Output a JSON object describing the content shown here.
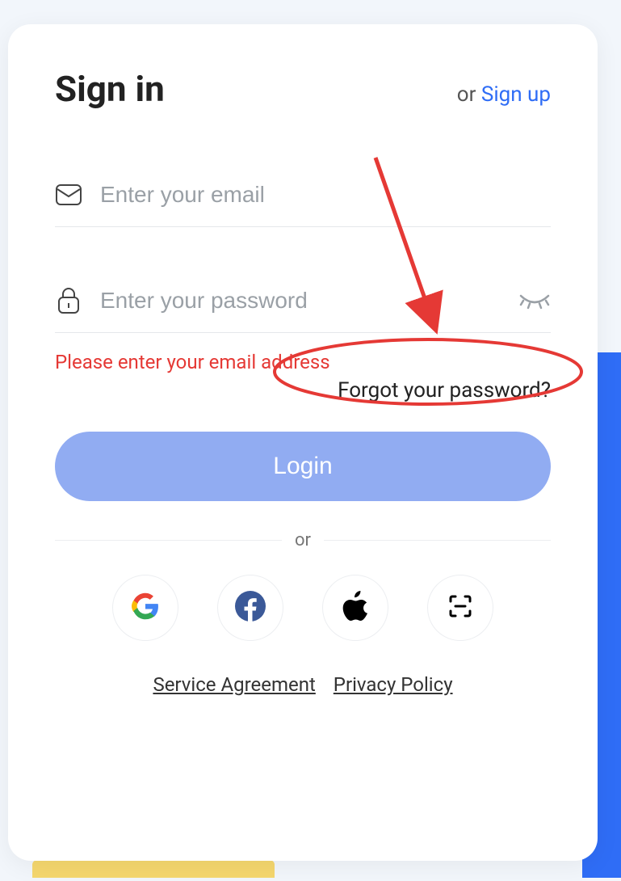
{
  "header": {
    "title": "Sign in",
    "switch_prefix": "or ",
    "switch_link": "Sign up"
  },
  "fields": {
    "email_placeholder": "Enter your email",
    "email_value": "",
    "password_placeholder": "Enter your password",
    "password_value": ""
  },
  "error_text": "Please enter your email address",
  "forgot_text": "Forgot your password?",
  "login_label": "Login",
  "divider_label": "or",
  "links": {
    "service": "Service Agreement",
    "privacy": "Privacy Policy"
  }
}
